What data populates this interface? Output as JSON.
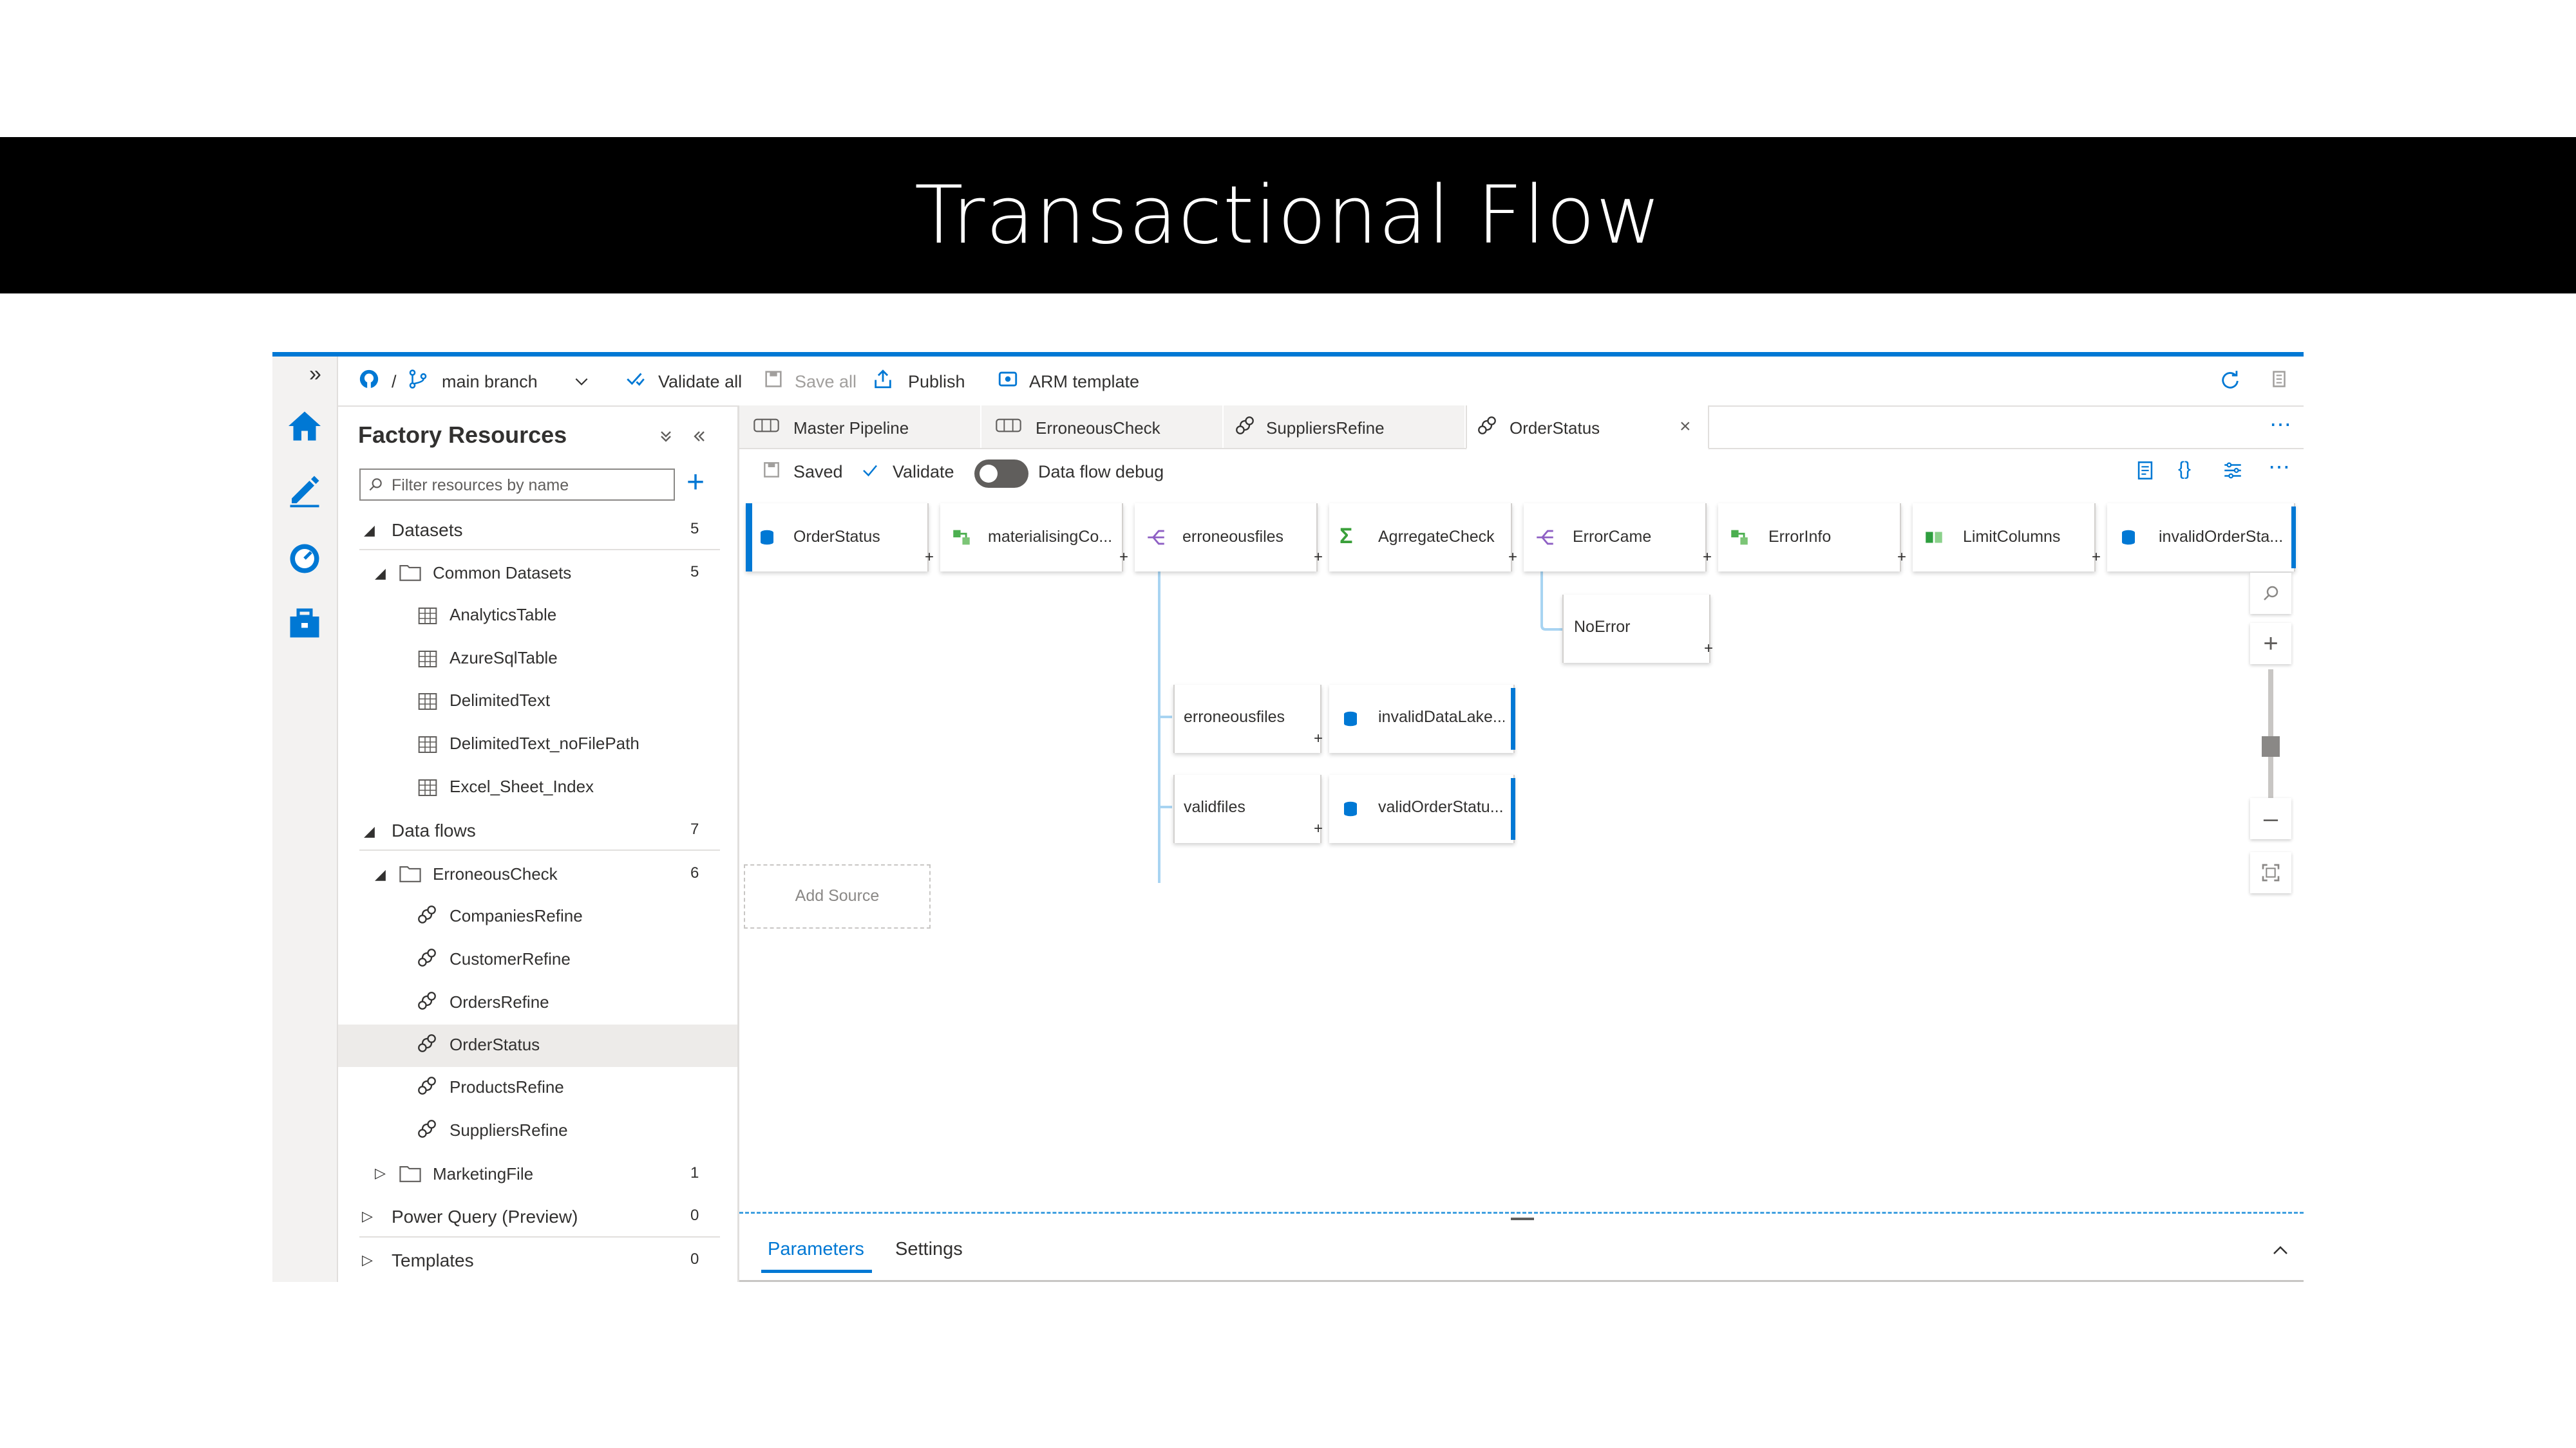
{
  "slide": {
    "title": "Transactional Flow"
  },
  "toolbar": {
    "separator": "/",
    "branch": "main branch",
    "validate_all": "Validate all",
    "save_all": "Save all",
    "publish": "Publish",
    "arm_template": "ARM template"
  },
  "resources": {
    "title": "Factory Resources",
    "filter_placeholder": "Filter resources by name",
    "datasets": {
      "label": "Datasets",
      "count": "5",
      "folder": {
        "label": "Common Datasets",
        "count": "5"
      },
      "items": [
        "AnalyticsTable",
        "AzureSqlTable",
        "DelimitedText",
        "DelimitedText_noFilePath",
        "Excel_Sheet_Index"
      ]
    },
    "dataflows": {
      "label": "Data flows",
      "count": "7",
      "folder": {
        "label": "ErroneousCheck",
        "count": "6"
      },
      "items": [
        "CompaniesRefine",
        "CustomerRefine",
        "OrdersRefine",
        "OrderStatus",
        "ProductsRefine",
        "SuppliersRefine"
      ],
      "folder2": {
        "label": "MarketingFile",
        "count": "1"
      }
    },
    "power_query": {
      "label": "Power Query (Preview)",
      "count": "0"
    },
    "templates": {
      "label": "Templates",
      "count": "0"
    }
  },
  "tabs": [
    "Master Pipeline",
    "ErroneousCheck",
    "SuppliersRefine",
    "OrderStatus"
  ],
  "tab_close": "×",
  "flow_toolbar": {
    "saved": "Saved",
    "validate": "Validate",
    "debug": "Data flow debug"
  },
  "canvas": {
    "nodes": {
      "n1": "OrderStatus",
      "n2": "materialisingCo...",
      "n3": "erroneousfiles",
      "n4": "AgrregateCheck",
      "n5": "ErrorCame",
      "n6": "ErrorInfo",
      "n7": "LimitColumns",
      "n8": "invalidOrderSta...",
      "n9": "NoError",
      "n10": "erroneousfiles",
      "n11": "invalidDataLake...",
      "n12": "validfiles",
      "n13": "validOrderStatu..."
    },
    "add_source": "Add Source"
  },
  "bottom": {
    "parameters": "Parameters",
    "settings": "Settings"
  },
  "icons": {
    "rail": [
      "home-icon",
      "pencil-icon",
      "monitor-icon",
      "toolbox-icon"
    ],
    "toolbar": [
      "github-icon",
      "branch-icon",
      "chevron-down-icon",
      "validate-icon",
      "save-icon",
      "publish-icon",
      "arm-template-icon",
      "refresh-icon",
      "discard-icon"
    ]
  },
  "colors": {
    "accent": "#0078d4",
    "title_band": "#000000",
    "selected_row": "#edebe9"
  }
}
